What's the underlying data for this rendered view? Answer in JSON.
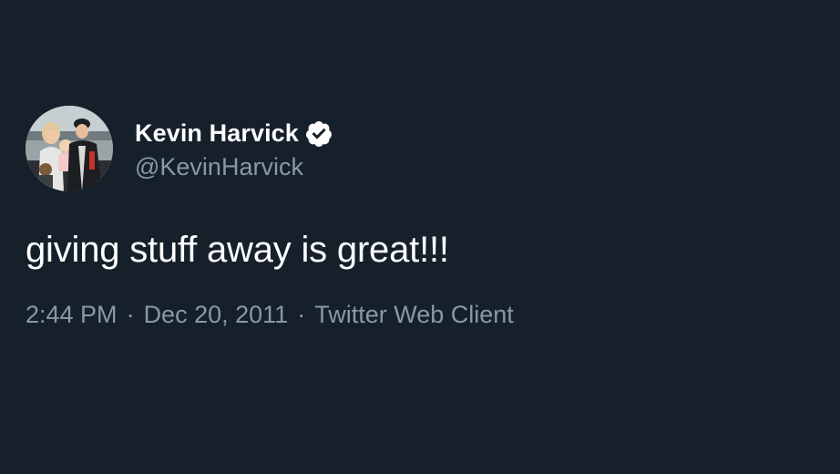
{
  "author": {
    "display_name": "Kevin Harvick",
    "handle": "@KevinHarvick",
    "verified": true,
    "avatar_icon": "profile-photo"
  },
  "tweet": {
    "text": "giving stuff away is great!!!",
    "time": "2:44 PM",
    "date": "Dec 20, 2011",
    "source": "Twitter Web Client",
    "separator": "·"
  },
  "colors": {
    "background": "#15202b",
    "primary_text": "#ffffff",
    "secondary_text": "#8899a6",
    "verified_badge": "#ffffff"
  }
}
